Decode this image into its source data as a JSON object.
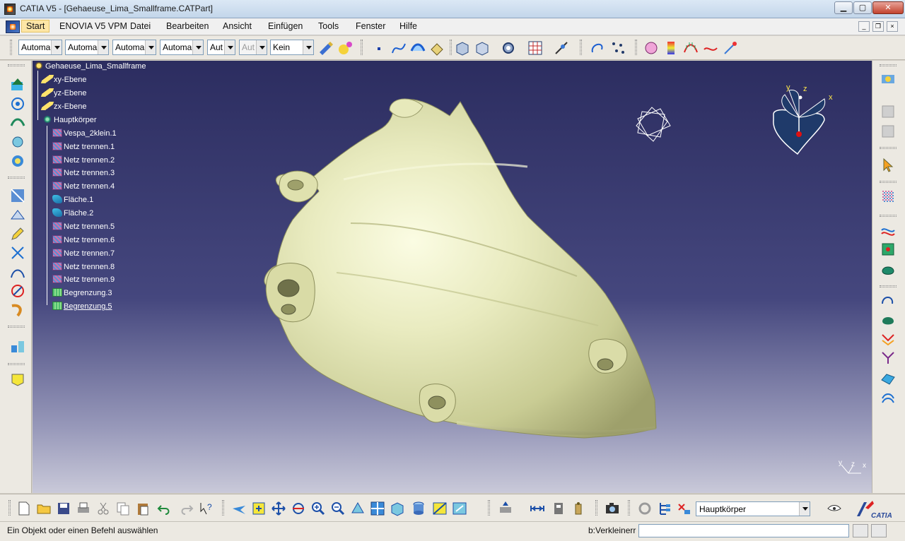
{
  "window": {
    "title": "CATIA V5 - [Gehaeuse_Lima_Smallframe.CATPart]",
    "min_label": "▁",
    "max_label": "▢",
    "close_label": "✕"
  },
  "menubar": {
    "items": [
      "Start",
      "ENOVIA V5 VPM",
      "Datei",
      "Bearbeiten",
      "Ansicht",
      "Einfügen",
      "Tools",
      "Fenster",
      "Hilfe"
    ],
    "active": "Start"
  },
  "toolbar_top": {
    "combos": [
      {
        "value": "Automa",
        "disabled": false
      },
      {
        "value": "Automa",
        "disabled": false
      },
      {
        "value": "Automa",
        "disabled": false
      },
      {
        "value": "Automa",
        "disabled": false
      },
      {
        "value": "Aut",
        "disabled": false
      },
      {
        "value": "Aut",
        "disabled": true
      },
      {
        "value": "Kein",
        "disabled": false
      }
    ]
  },
  "tree": {
    "root": "Gehaeuse_Lima_Smallframe",
    "planes": [
      "xy-Ebene",
      "yz-Ebene",
      "zx-Ebene"
    ],
    "body": "Hauptkörper",
    "children": [
      {
        "label": "Vespa_2klein.1",
        "icon": "mesh"
      },
      {
        "label": "Netz trennen.1",
        "icon": "mesh"
      },
      {
        "label": "Netz trennen.2",
        "icon": "mesh"
      },
      {
        "label": "Netz trennen.3",
        "icon": "mesh"
      },
      {
        "label": "Netz trennen.4",
        "icon": "mesh"
      },
      {
        "label": "Fläche.1",
        "icon": "surf"
      },
      {
        "label": "Fläche.2",
        "icon": "surf"
      },
      {
        "label": "Netz trennen.5",
        "icon": "mesh"
      },
      {
        "label": "Netz trennen.6",
        "icon": "mesh"
      },
      {
        "label": "Netz trennen.7",
        "icon": "mesh"
      },
      {
        "label": "Netz trennen.8",
        "icon": "mesh"
      },
      {
        "label": "Netz trennen.9",
        "icon": "mesh"
      },
      {
        "label": "Begrenzung.3",
        "icon": "bound"
      },
      {
        "label": "Begrenzung.5",
        "icon": "bound"
      }
    ]
  },
  "compass": {
    "x": "x",
    "y": "y",
    "z": "z"
  },
  "axis_mini": {
    "y": "y",
    "z": "z",
    "x": "x"
  },
  "toolbar_bottom": {
    "current_body": "Hauptkörper"
  },
  "statusbar": {
    "message": "Ein Objekt oder einen Befehl auswählen",
    "command_label": "b:Verkleinerr",
    "command_value": ""
  },
  "colors": {
    "model_fill": "#e6e8b8",
    "viewport_top": "#2c2d60",
    "viewport_bottom": "#c9c9d9"
  }
}
